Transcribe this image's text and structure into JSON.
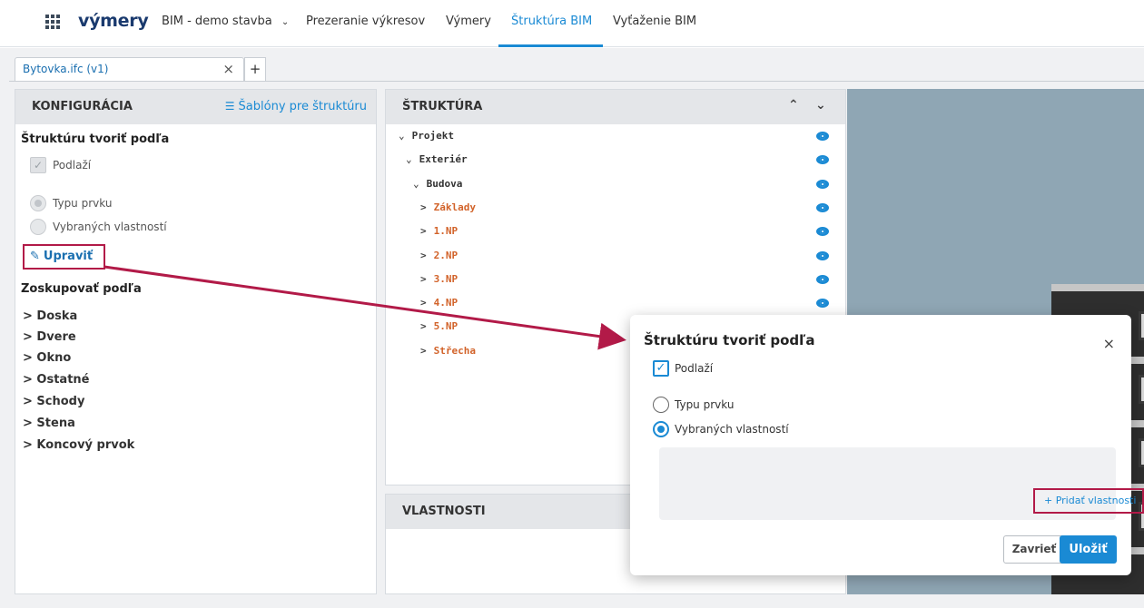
{
  "nav": {
    "brand": "výmery",
    "project": "BIM - demo stavba",
    "items": [
      "Prezeranie výkresov",
      "Výmery",
      "Štruktúra BIM",
      "Vyťaženie BIM"
    ],
    "active_item": "Štruktúra BIM"
  },
  "file_tab": {
    "name": "Bytovka.ifc (v1)",
    "close": "×",
    "add": "+"
  },
  "config": {
    "title": "KONFIGURÁCIA",
    "templates_link": "Šablóny pre štruktúru",
    "build_by": "Štruktúru tvoriť podľa",
    "floors_label": "Podlaží",
    "type_label": "Typu prvku",
    "props_label": "Vybraných vlastností",
    "edit_label": "Upraviť",
    "group_by": "Zoskupovať podľa",
    "groups": [
      "> Doska",
      "> Dvere",
      "> Okno",
      "> Ostatné",
      "> Schody",
      "> Stena",
      "> Koncový prvok"
    ]
  },
  "structure": {
    "title": "ŠTRUKTÚRA",
    "tree": [
      {
        "prefix": "⌄",
        "label": "Projekt",
        "orange": false,
        "eye": true
      },
      {
        "prefix": "⌄",
        "label": "Exteriér",
        "orange": false,
        "eye": true
      },
      {
        "prefix": "⌄",
        "label": "Budova",
        "orange": false,
        "eye": true
      },
      {
        "prefix": ">",
        "label": "Základy",
        "orange": true,
        "eye": true
      },
      {
        "prefix": ">",
        "label": "1.NP",
        "orange": true,
        "eye": true
      },
      {
        "prefix": ">",
        "label": "2.NP",
        "orange": true,
        "eye": true
      },
      {
        "prefix": ">",
        "label": "3.NP",
        "orange": true,
        "eye": true
      },
      {
        "prefix": ">",
        "label": "4.NP",
        "orange": true,
        "eye": true
      },
      {
        "prefix": ">",
        "label": "5.NP",
        "orange": true,
        "eye": false
      },
      {
        "prefix": ">",
        "label": "Střecha",
        "orange": true,
        "eye": false
      }
    ]
  },
  "properties": {
    "title": "VLASTNOSTI"
  },
  "modal": {
    "title": "Štruktúru tvoriť podľa",
    "close": "×",
    "floors_label": "Podlaží",
    "type_label": "Typu prvku",
    "props_label": "Vybraných vlastností",
    "add_prop": "+ Pridať vlastnosti",
    "cancel": "Zavrieť",
    "save": "Uložiť"
  },
  "colors": {
    "accent": "#1a8ad4",
    "highlight": "#b21a48",
    "tree_orange": "#d2632a"
  }
}
